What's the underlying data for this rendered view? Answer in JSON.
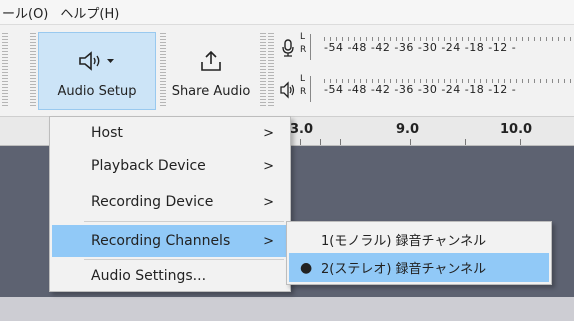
{
  "menubar": {
    "items": [
      "ール(O)",
      "ヘルプ(H)"
    ]
  },
  "toolbar": {
    "audio_setup_label": "Audio Setup",
    "share_audio_label": "Share Audio",
    "dropdown_glyph": "▾"
  },
  "meters": {
    "record": {
      "L": "L",
      "R": "R",
      "scale": "-54  -48  -42  -36  -30  -24  -18  -12  -"
    },
    "playback": {
      "L": "L",
      "R": "R",
      "scale": "-54  -48  -42  -36  -30  -24  -18  -12  -"
    }
  },
  "ruler": {
    "labels": [
      "3.0",
      "9.0",
      "10.0"
    ]
  },
  "menu": {
    "items": [
      {
        "label": "Host",
        "arrow": ">"
      },
      {
        "label": "Playback Device",
        "arrow": ">"
      },
      {
        "label": "Recording Device",
        "arrow": ">"
      },
      {
        "label": "Recording Channels",
        "arrow": ">"
      },
      {
        "label": "Audio Settings..."
      }
    ]
  },
  "submenu": {
    "items": [
      {
        "label": "1(モノラル) 録音チャンネル"
      },
      {
        "label": "2(ステレオ) 録音チャンネル",
        "bullet": "●"
      }
    ]
  },
  "colors": {
    "highlight": "#91c9f7",
    "track": "#5d6271",
    "active_button": "#cce4f7"
  }
}
